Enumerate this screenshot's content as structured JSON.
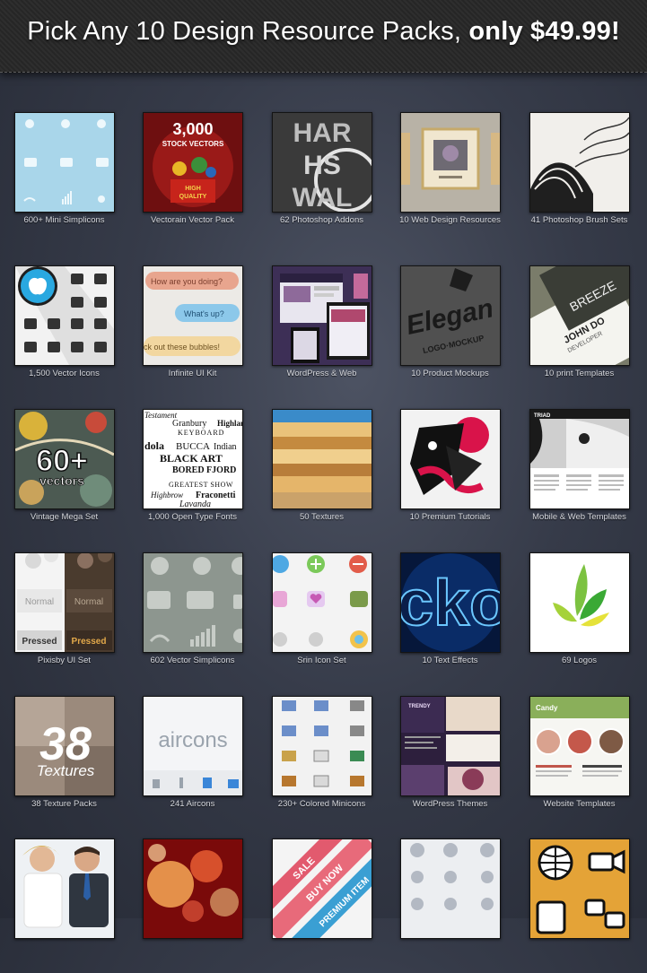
{
  "header": {
    "title_plain": "Pick Any 10 Design Resource Packs,",
    "title_bold": "only $49.99!"
  },
  "packs": [
    {
      "label": "600+ Mini Simplicons",
      "icon": "simplicons-icon"
    },
    {
      "label": "Vectorain Vector Pack",
      "icon": "vector-pack-icon",
      "text_lines": [
        "3,000",
        "STOCK VECTORS",
        "HIGH",
        "QUALITY"
      ]
    },
    {
      "label": "62 Photoshop Addons",
      "icon": "photoshop-addons-icon",
      "text_lines": [
        "HAR",
        "HS",
        "WAL"
      ]
    },
    {
      "label": "10 Web Design Resources",
      "icon": "frame-icon"
    },
    {
      "label": "41 Photoshop Brush Sets",
      "icon": "brush-icon"
    },
    {
      "label": "1,500 Vector Icons",
      "icon": "apple-icon"
    },
    {
      "label": "Infinite UI Kit",
      "icon": "chat-bubbles-icon",
      "text_lines": [
        "How are you doing?",
        "What's up?",
        "ck out these bubbles!"
      ]
    },
    {
      "label": "WordPress & Web",
      "icon": "devices-icon"
    },
    {
      "label": "10 Product Mockups",
      "icon": "logo-mockup-icon",
      "text_lines": [
        "Elegan",
        "LOGO·MOCKUP"
      ]
    },
    {
      "label": "10 print Templates",
      "icon": "business-card-icon",
      "text_lines": [
        "BREEZE",
        "JOHN DO",
        "DEVELOPER"
      ]
    },
    {
      "label": "Vintage Mega Set",
      "icon": "vintage-icon",
      "text_lines": [
        "60+",
        "vectors"
      ]
    },
    {
      "label": "1,000 Open Type Fonts",
      "icon": "fonts-icon",
      "text_lines": [
        "Testament",
        "Granbury",
        "Highland",
        "KEYBOARD",
        "dola",
        "BUCCA",
        "Indian",
        "BLACK ART",
        "BORED FJORD",
        "GREATEST SHOW",
        "Highbrow",
        "Fraconetti",
        "Lavanda"
      ]
    },
    {
      "label": "50 Textures",
      "icon": "texture-icon"
    },
    {
      "label": "10 Premium Tutorials",
      "icon": "tutorial-art-icon"
    },
    {
      "label": "Mobile & Web Templates",
      "icon": "web-template-icon",
      "text_lines": [
        "TRIAD"
      ]
    },
    {
      "label": "Pixisby UI Set",
      "icon": "ui-set-icon",
      "text_lines": [
        "Normal",
        "Normal",
        "Pressed",
        "Pressed"
      ]
    },
    {
      "label": "602 Vector Simplicons",
      "icon": "gray-simplicons-icon"
    },
    {
      "label": "Srin Icon Set",
      "icon": "srin-icon"
    },
    {
      "label": "10 Text Effects",
      "icon": "neon-text-icon",
      "text_lines": [
        "cko"
      ]
    },
    {
      "label": "69 Logos",
      "icon": "leaf-logo-icon"
    },
    {
      "label": "38 Texture Packs",
      "icon": "texture-pack-icon",
      "text_lines": [
        "38",
        "Textures"
      ]
    },
    {
      "label": "241 Aircons",
      "icon": "aircons-icon",
      "text_lines": [
        "aircons"
      ]
    },
    {
      "label": "230+ Colored Minicons",
      "icon": "minicons-icon"
    },
    {
      "label": "WordPress Themes",
      "icon": "wp-theme-icon",
      "text_lines": [
        "TRENDY"
      ]
    },
    {
      "label": "Website Templates",
      "icon": "website-icon",
      "text_lines": [
        "Candy"
      ]
    },
    {
      "label": "",
      "icon": "business-people-icon"
    },
    {
      "label": "",
      "icon": "bokeh-icon"
    },
    {
      "label": "",
      "icon": "ribbons-icon",
      "text_lines": [
        "SALE",
        "BUY NOW",
        "PREMIUM ITEM"
      ]
    },
    {
      "label": "",
      "icon": "outline-icons-icon"
    },
    {
      "label": "",
      "icon": "social-icons-icon"
    }
  ]
}
